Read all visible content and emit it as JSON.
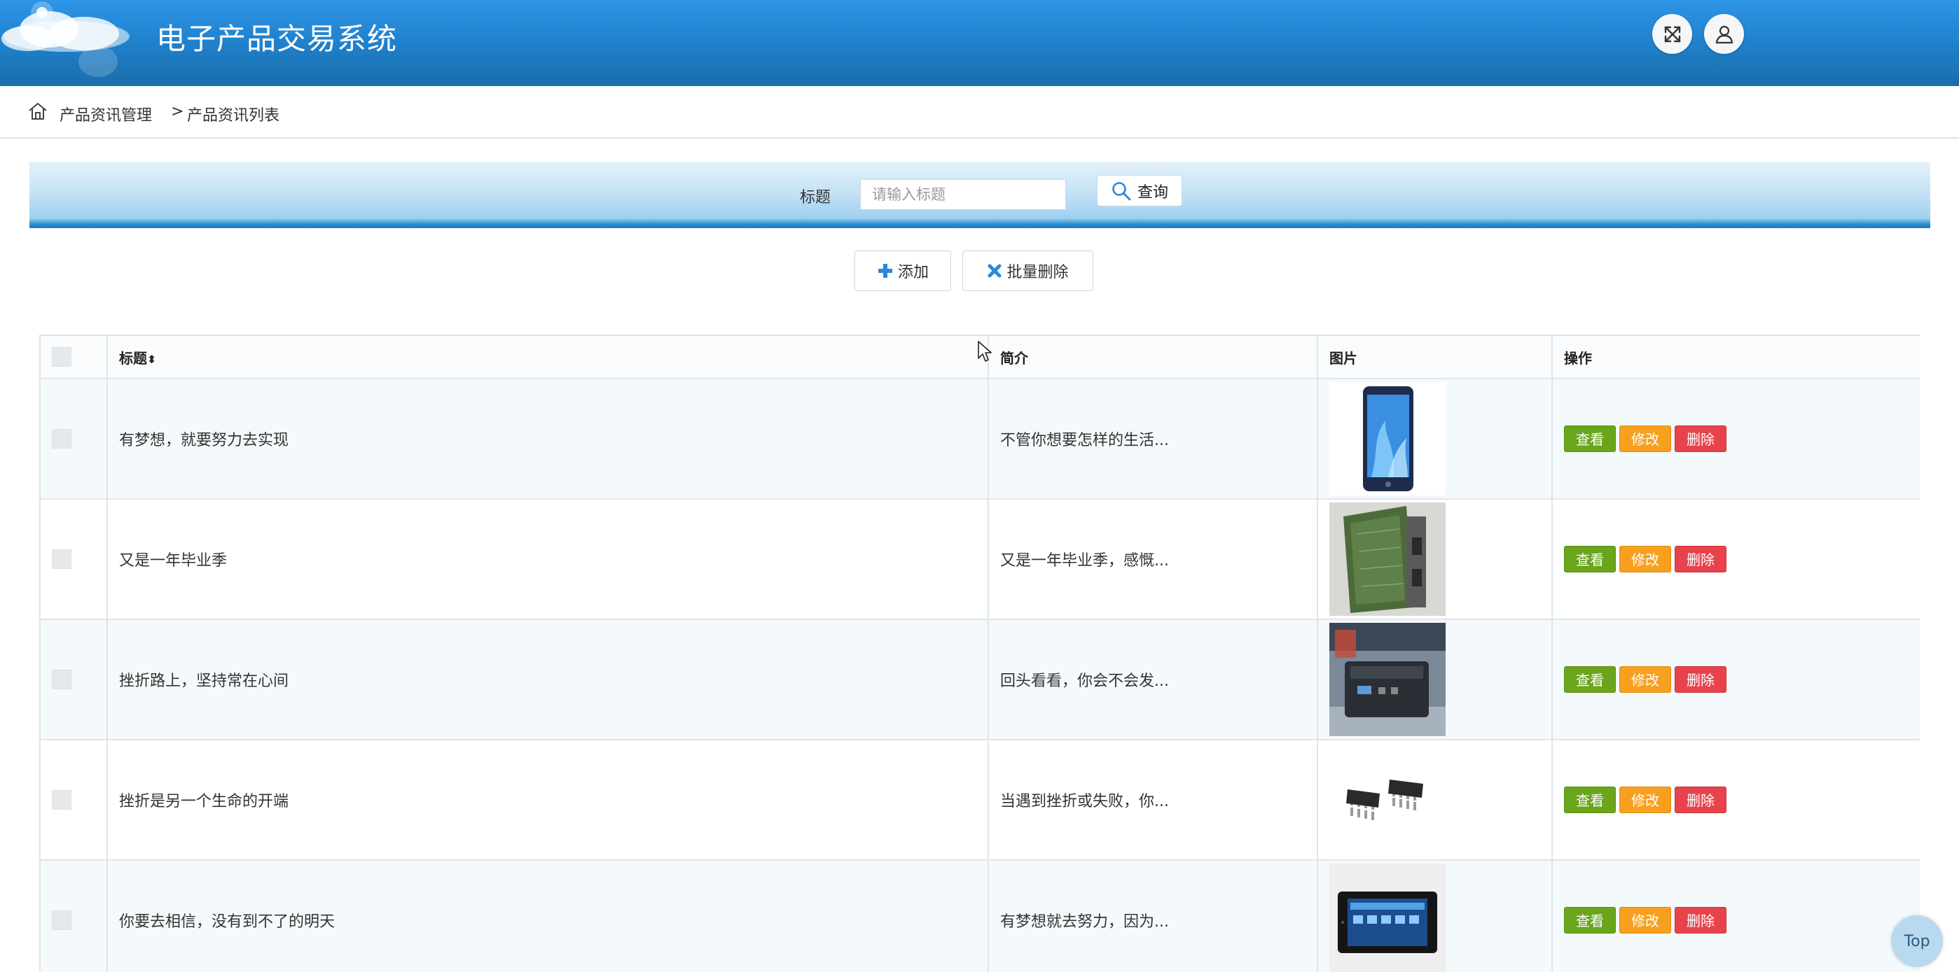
{
  "app": {
    "title": "电子产品交易系统"
  },
  "header": {
    "fullscreen_icon": "expand-icon",
    "user_icon": "user-icon"
  },
  "breadcrumb": {
    "home_icon": "home-icon",
    "items": [
      "产品资讯管理",
      "产品资讯列表"
    ],
    "separator": ">"
  },
  "search": {
    "label": "标题",
    "placeholder": "请输入标题",
    "value": "",
    "button_label": "查询"
  },
  "actions": {
    "add_label": "添加",
    "batch_delete_label": "批量删除"
  },
  "table": {
    "columns": [
      "标题",
      "简介",
      "图片",
      "操作"
    ],
    "sort_indicator": "⬍",
    "rows": [
      {
        "title": "有梦想，就要努力去实现",
        "summary": "不管你想要怎样的生活...",
        "image": "phone"
      },
      {
        "title": "又是一年毕业季",
        "summary": "又是一年毕业季，感慨...",
        "image": "circuit-board"
      },
      {
        "title": "挫折路上，坚持常在心间",
        "summary": "回头看看，你会不会发...",
        "image": "power-station"
      },
      {
        "title": "挫折是另一个生命的开端",
        "summary": "当遇到挫折或失败，你...",
        "image": "chips"
      },
      {
        "title": "你要去相信，没有到不了的明天",
        "summary": "有梦想就去努力，因为...",
        "image": "tablet"
      }
    ],
    "row_actions": {
      "view": "查看",
      "edit": "修改",
      "delete": "删除"
    }
  },
  "floating": {
    "top_label": "Top"
  },
  "colors": {
    "header": "#1f7fc9",
    "view": "#6aa51b",
    "edit": "#f7a01f",
    "delete": "#e8434d"
  }
}
